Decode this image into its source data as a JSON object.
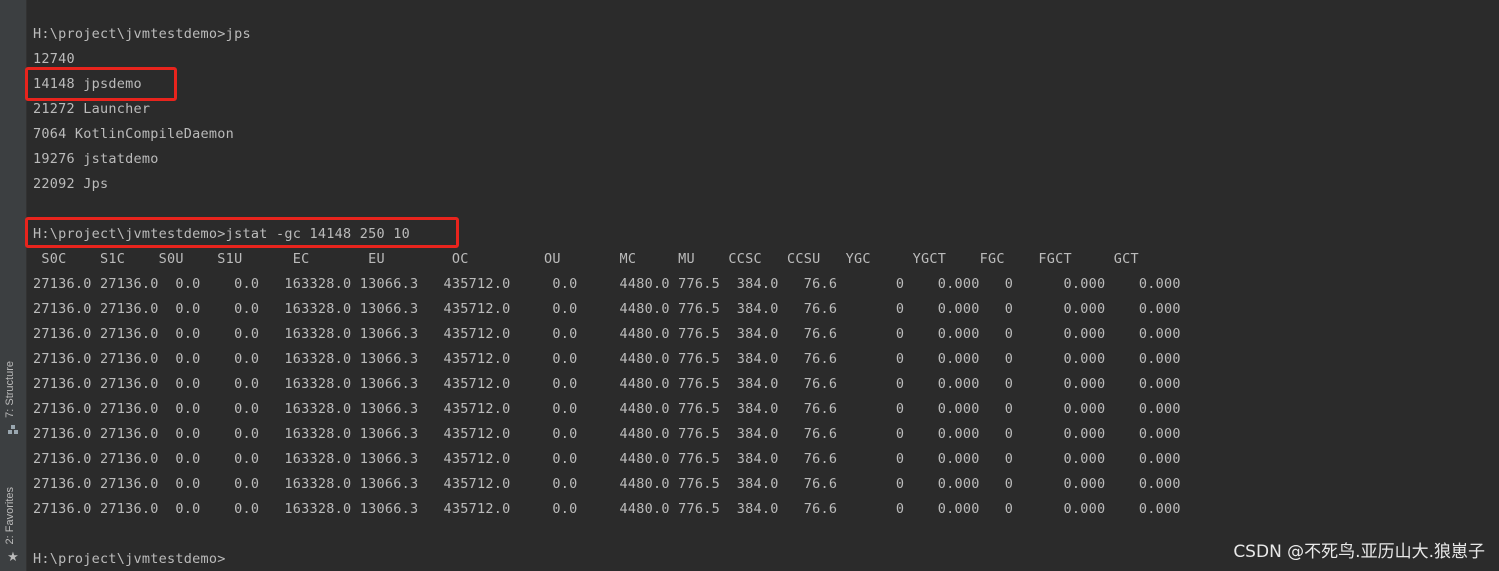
{
  "sidebar": {
    "structure_label": "7: Structure",
    "structure_icon": "structure-icon",
    "favorites_label": "2: Favorites",
    "favorites_icon": "star-icon"
  },
  "terminal": {
    "lines": [
      "H:\\project\\jvmtestdemo>jps",
      "12740",
      "14148 jpsdemo",
      "21272 Launcher",
      "7064 KotlinCompileDaemon",
      "19276 jstatdemo",
      "22092 Jps",
      "",
      "H:\\project\\jvmtestdemo>jstat -gc 14148 250 10",
      " S0C    S1C    S0U    S1U      EC       EU        OC         OU       MC     MU    CCSC   CCSU   YGC     YGCT    FGC    FGCT     GCT",
      "27136.0 27136.0  0.0    0.0   163328.0 13066.3   435712.0     0.0     4480.0 776.5  384.0   76.6       0    0.000   0      0.000    0.000",
      "27136.0 27136.0  0.0    0.0   163328.0 13066.3   435712.0     0.0     4480.0 776.5  384.0   76.6       0    0.000   0      0.000    0.000",
      "27136.0 27136.0  0.0    0.0   163328.0 13066.3   435712.0     0.0     4480.0 776.5  384.0   76.6       0    0.000   0      0.000    0.000",
      "27136.0 27136.0  0.0    0.0   163328.0 13066.3   435712.0     0.0     4480.0 776.5  384.0   76.6       0    0.000   0      0.000    0.000",
      "27136.0 27136.0  0.0    0.0   163328.0 13066.3   435712.0     0.0     4480.0 776.5  384.0   76.6       0    0.000   0      0.000    0.000",
      "27136.0 27136.0  0.0    0.0   163328.0 13066.3   435712.0     0.0     4480.0 776.5  384.0   76.6       0    0.000   0      0.000    0.000",
      "27136.0 27136.0  0.0    0.0   163328.0 13066.3   435712.0     0.0     4480.0 776.5  384.0   76.6       0    0.000   0      0.000    0.000",
      "27136.0 27136.0  0.0    0.0   163328.0 13066.3   435712.0     0.0     4480.0 776.5  384.0   76.6       0    0.000   0      0.000    0.000",
      "27136.0 27136.0  0.0    0.0   163328.0 13066.3   435712.0     0.0     4480.0 776.5  384.0   76.6       0    0.000   0      0.000    0.000",
      "27136.0 27136.0  0.0    0.0   163328.0 13066.3   435712.0     0.0     4480.0 776.5  384.0   76.6       0    0.000   0      0.000    0.000",
      "",
      "H:\\project\\jvmtestdemo>"
    ]
  },
  "watermark": "CSDN @不死鸟.亚历山大.狼崽子",
  "colors": {
    "background": "#2b2b2b",
    "text": "#bbbbbb",
    "highlight_box": "#e8241d"
  }
}
